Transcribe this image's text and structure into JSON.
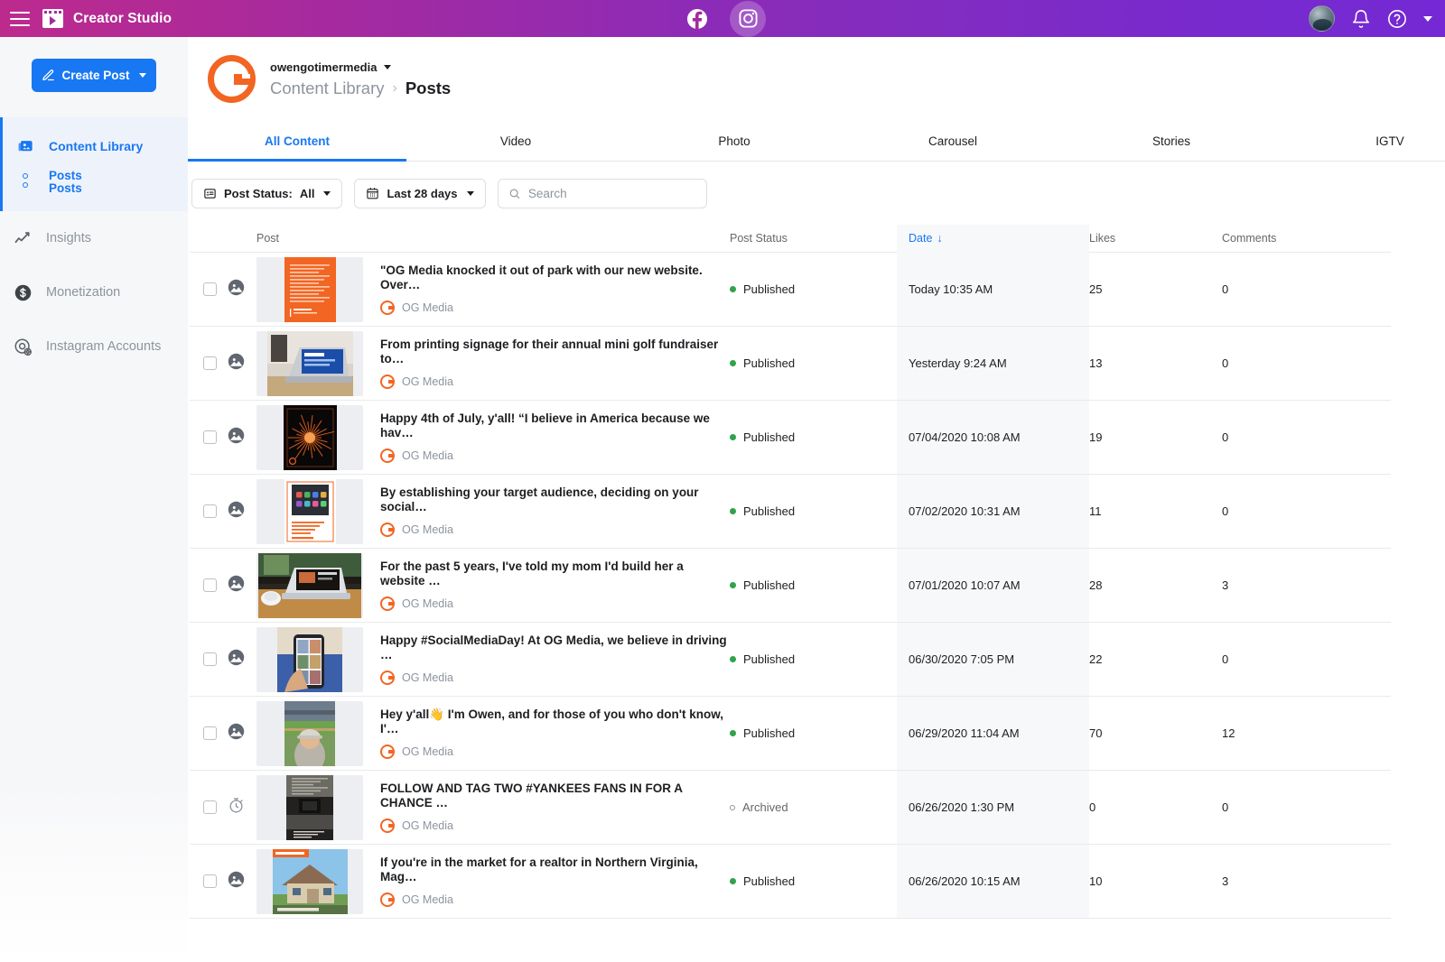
{
  "topbar": {
    "menu_icon": "hamburger-menu-icon",
    "brand_icon": "creator-studio-logo-icon",
    "brand_title": "Creator Studio",
    "platforms": [
      {
        "name": "facebook",
        "icon": "facebook-icon",
        "active": false
      },
      {
        "name": "instagram",
        "icon": "instagram-icon",
        "active": true
      }
    ],
    "avatar_icon": "user-avatar",
    "notifications_icon": "bell-icon",
    "help_icon": "question-circle-icon",
    "account_menu_icon": "chevron-down-icon"
  },
  "sidebar": {
    "create_post_label": "Create Post",
    "create_post_icon": "compose-icon",
    "create_post_caret_icon": "chevron-down-icon",
    "accent_color": "#1877f2",
    "content_library": {
      "label": "Content Library",
      "icon": "content-library-icon",
      "sub_items": [
        "Posts",
        "Posts"
      ]
    },
    "items": [
      {
        "label": "Insights",
        "icon": "insights-chart-icon"
      },
      {
        "label": "Monetization",
        "icon": "dollar-circle-icon"
      },
      {
        "label": "Instagram Accounts",
        "icon": "instagram-accounts-icon"
      }
    ]
  },
  "header": {
    "brand_logo_icon": "og-media-circle-logo",
    "account_name": "owengotimermedia",
    "account_caret_icon": "chevron-down-icon",
    "breadcrumb": {
      "parent": "Content Library",
      "separator": "›",
      "current": "Posts"
    }
  },
  "tabs": [
    {
      "label": "All Content",
      "active": true
    },
    {
      "label": "Video",
      "active": false
    },
    {
      "label": "Photo",
      "active": false
    },
    {
      "label": "Carousel",
      "active": false
    },
    {
      "label": "Stories",
      "active": false
    },
    {
      "label": "IGTV",
      "active": false
    }
  ],
  "filters": {
    "post_status": {
      "icon": "post-status-icon",
      "label": "Post Status:",
      "value": "All",
      "caret_icon": "chevron-down-icon"
    },
    "date_range": {
      "icon": "calendar-icon",
      "value": "Last 28 days",
      "caret_icon": "chevron-down-icon"
    },
    "search": {
      "icon": "search-icon",
      "placeholder": "Search",
      "value": ""
    }
  },
  "table": {
    "columns": [
      "Post",
      "Post Status",
      "Date",
      "Likes",
      "Comments"
    ],
    "sort_column": "Date",
    "sort_icon": "arrow-down-icon",
    "rows": [
      {
        "media_icon": "photo-icon",
        "title": "\"OG Media knocked it out of park with our new website. Over…",
        "author": "OG Media",
        "status": "Published",
        "status_type": "published",
        "date": "Today 10:35 AM",
        "likes": "25",
        "comments": "0",
        "thumb": "orange-text-card"
      },
      {
        "media_icon": "photo-icon",
        "title": "From printing signage for their annual mini golf fundraiser to…",
        "author": "OG Media",
        "status": "Published",
        "status_type": "published",
        "date": "Yesterday 9:24 AM",
        "likes": "13",
        "comments": "0",
        "thumb": "laptop-desk"
      },
      {
        "media_icon": "photo-icon",
        "title": "Happy 4th of July, y'all! “I believe in America because we hav…",
        "author": "OG Media",
        "status": "Published",
        "status_type": "published",
        "date": "07/04/2020 10:08 AM",
        "likes": "19",
        "comments": "0",
        "thumb": "fireworks"
      },
      {
        "media_icon": "photo-icon",
        "title": "By establishing your target audience, deciding on your social…",
        "author": "OG Media",
        "status": "Published",
        "status_type": "published",
        "date": "07/02/2020 10:31 AM",
        "likes": "11",
        "comments": "0",
        "thumb": "phone-apps-card"
      },
      {
        "media_icon": "photo-icon",
        "title": "For the past 5 years, I've told my mom I'd build her a website …",
        "author": "OG Media",
        "status": "Published",
        "status_type": "published",
        "date": "07/01/2020 10:07 AM",
        "likes": "28",
        "comments": "3",
        "thumb": "laptop-cafe"
      },
      {
        "media_icon": "photo-icon",
        "title": "Happy #SocialMediaDay! At OG Media, we believe in driving …",
        "author": "OG Media",
        "status": "Published",
        "status_type": "published",
        "date": "06/30/2020 7:05 PM",
        "likes": "22",
        "comments": "0",
        "thumb": "phone-in-hand"
      },
      {
        "media_icon": "photo-icon",
        "title": "Hey y'all👋 I'm Owen, and for those of you who don't know, I'…",
        "author": "OG Media",
        "status": "Published",
        "status_type": "published",
        "date": "06/29/2020 11:04 AM",
        "likes": "70",
        "comments": "12",
        "thumb": "ballpark-selfie"
      },
      {
        "media_icon": "stopwatch-icon",
        "title": "FOLLOW AND TAG TWO #YANKEES FANS IN FOR A CHANCE …",
        "author": "OG Media",
        "status": "Archived",
        "status_type": "archived",
        "date": "06/26/2020 1:30 PM",
        "likes": "0",
        "comments": "0",
        "thumb": "dark-story"
      },
      {
        "media_icon": "photo-icon",
        "title": "If you're in the market for a realtor in Northern Virginia, Mag…",
        "author": "OG Media",
        "status": "Published",
        "status_type": "published",
        "date": "06/26/2020 10:15 AM",
        "likes": "10",
        "comments": "3",
        "thumb": "house-listing"
      }
    ]
  },
  "colors": {
    "accent": "#1877f2",
    "brand_orange": "#f26522",
    "published_green": "#31a24c",
    "topbar_start": "#bd2a8e",
    "topbar_end": "#7429d4"
  }
}
